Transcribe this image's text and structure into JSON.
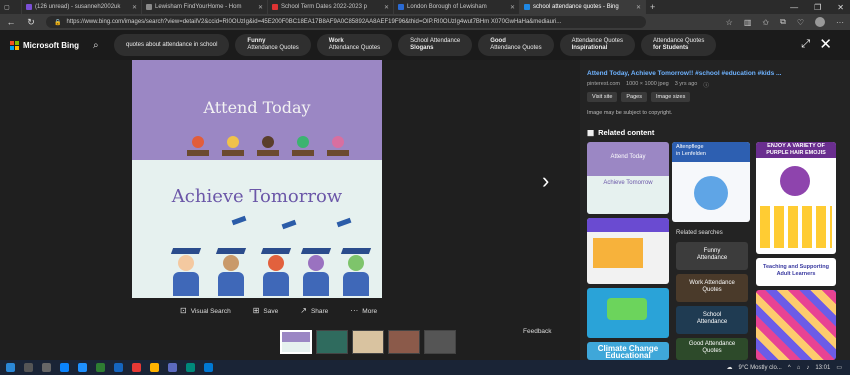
{
  "tabs": [
    {
      "label": "(126 unread) - susanneh2002uk",
      "color": "#7b4fd6"
    },
    {
      "label": "Lewisham FindYourHome - Hom",
      "color": "#8a8a8a"
    },
    {
      "label": "School Term Dates 2022-2023 p",
      "color": "#d33"
    },
    {
      "label": "London Borough of Lewisham",
      "color": "#2a6ad3"
    },
    {
      "label": "school attendance quotes - Bing",
      "color": "#1e88e5"
    }
  ],
  "browser": {
    "url": "https://www.bing.com/images/search?view=detailV2&ccid=RI0OUzIg&id=45E200F0BC18EA17B8AF9A0C85892AA8AEF19F96&thid=OIP.RI0OUzIg4wut7BHm X070GwHaHa&mediauri..."
  },
  "bing": {
    "logo_text": "Microsoft Bing",
    "chips": [
      {
        "line1": "quotes about attendance in school",
        "line2": ""
      },
      {
        "line1": "Funny",
        "line2": "Attendance Quotes"
      },
      {
        "line1": "Work",
        "line2": "Attendance Quotes"
      },
      {
        "line1": "School Attendance",
        "line2": "Slogans"
      },
      {
        "line1": "Good",
        "line2": "Attendance Quotes"
      },
      {
        "line1": "Attendance Quotes",
        "line2": "Inspirational"
      },
      {
        "line1": "Attendance Quotes",
        "line2": "for Students"
      }
    ]
  },
  "image": {
    "text_top": "Attend Today",
    "text_bottom": "Achieve Tomorrow",
    "colors": {
      "top": "#9b87c4",
      "bottom": "#e6f1ef"
    }
  },
  "actions": {
    "visual_search": "Visual Search",
    "save": "Save",
    "share": "Share",
    "more": "More"
  },
  "feedback": "Feedback",
  "side": {
    "title": "Attend Today, Achieve Tomorrow!! #school #education #kids ...",
    "source": "pinterest.com",
    "dims": "1000 × 1000 jpeg",
    "age": "3 yrs ago",
    "btns": [
      "Visit site",
      "Pages",
      "Image sizes"
    ],
    "copyright": "Image may be subject to copyright.",
    "related_title": "Related content",
    "related_searches_label": "Related searches",
    "cards": {
      "c1_top": "Attend Today",
      "c1_bottom": "Achieve Tomorrow",
      "c2_l1": "Altenpflege",
      "c2_l2": "in Lenfelden",
      "c3_top": "ENJOY A VARIETY OF",
      "c3_bottom": "PURPLE HAIR EMOJIS",
      "c4_top": "Teaching and Supporting",
      "c4_bottom": "Adult Learners",
      "c5": "Climate Change Educational"
    },
    "searches": [
      {
        "l1": "Funny",
        "l2": "Attendance"
      },
      {
        "l1": "Work Attendance",
        "l2": "Quotes"
      },
      {
        "l1": "School",
        "l2": "Attendance"
      },
      {
        "l1": "Good Attendance",
        "l2": "Quotes"
      }
    ]
  },
  "taskbar": {
    "weather": "9°C  Mostly clo...",
    "time": "13:01"
  }
}
